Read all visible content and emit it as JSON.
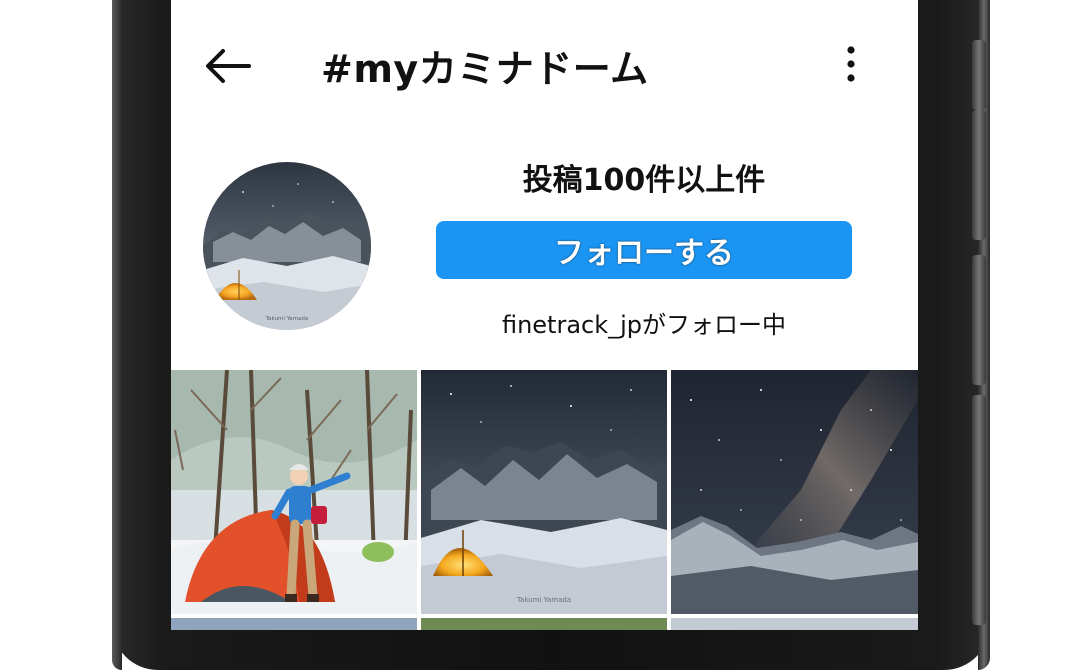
{
  "header": {
    "title": "#myカミナドーム",
    "back_icon": "back-arrow-icon",
    "more_icon": "more-vertical-icon"
  },
  "profile": {
    "post_count": "投稿100件以上件",
    "follow_label": "フォローする",
    "followed_by": "finetrack_jpがフォロー中",
    "avatar_watermark": "Takumi Yamada"
  },
  "grid": {
    "tiles": [
      {
        "subject": "hiker-with-orange-tent-in-snowy-forest"
      },
      {
        "subject": "lit-tent-under-night-mountains"
      },
      {
        "subject": "milky-way-over-snowy-peaks"
      }
    ],
    "watermark": "Takumi Yamada"
  },
  "colors": {
    "accent": "#1a95f3",
    "text": "#111111",
    "background": "#ffffff"
  }
}
